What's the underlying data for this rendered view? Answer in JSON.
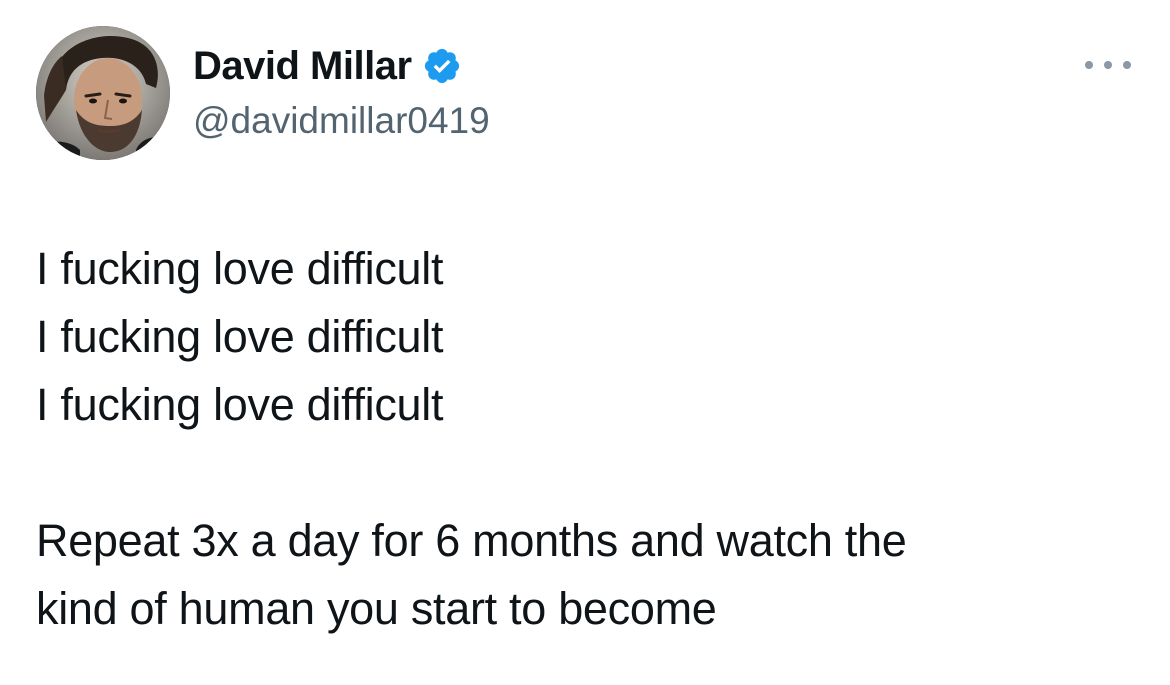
{
  "author": {
    "display_name": "David Millar",
    "handle": "@davidmillar0419",
    "verified": true,
    "verified_color": "#1d9bf0"
  },
  "icons": {
    "avatar": "profile-photo",
    "verified": "verified-badge-icon",
    "more": "more-options-icon"
  },
  "tweet": {
    "lines": [
      "I fucking love difficult",
      "I fucking love difficult",
      "I fucking love difficult"
    ],
    "closing_lines": [
      "Repeat 3x a day for 6 months and watch the",
      "kind of human you start to become"
    ]
  },
  "colors": {
    "text": "#0f1419",
    "secondary_text": "#536471",
    "more_icon": "#8b98a5"
  }
}
